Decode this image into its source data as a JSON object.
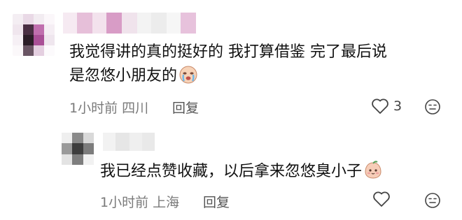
{
  "comments": [
    {
      "text": "我觉得讲的真的挺好的  我打算借鉴  完了最后说",
      "text_line2": "是忽悠小朋友的",
      "time": "1小时前",
      "location": "四川",
      "reply_label": "回复",
      "like_count": "3",
      "trailing_icon": "crying-face-emoji"
    },
    {
      "text": "我已经点赞收藏，以后拿来忽悠臭小子",
      "time": "1小时前",
      "location": "上海",
      "reply_label": "回复",
      "like_count": "",
      "trailing_icon": "peach-face-emoji"
    }
  ],
  "colors": {
    "text": "#111111",
    "meta": "#7a7a7a",
    "icon_stroke": "#444444"
  },
  "icons": [
    "heart-outline-icon",
    "emoji-reaction-icon"
  ]
}
